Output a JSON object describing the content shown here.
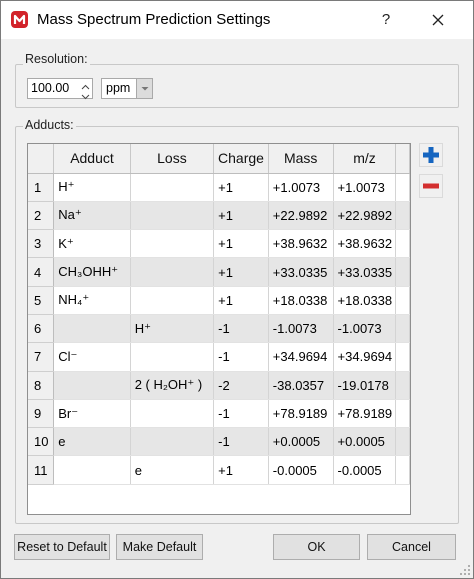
{
  "window": {
    "title": "Mass Spectrum Prediction Settings",
    "help_label": "?",
    "brand_color": "#d2232a"
  },
  "resolution": {
    "group_label": "Resolution:",
    "value": "100.00",
    "unit": "ppm"
  },
  "adducts": {
    "group_label": "Adducts:",
    "columns": [
      "Adduct",
      "Loss",
      "Charge",
      "Mass",
      "m/z"
    ],
    "rows": [
      {
        "num": "1",
        "adduct": "H⁺",
        "loss": "",
        "charge": "+1",
        "mass": "+1.0073",
        "mz": "+1.0073"
      },
      {
        "num": "2",
        "adduct": "Na⁺",
        "loss": "",
        "charge": "+1",
        "mass": "+22.9892",
        "mz": "+22.9892"
      },
      {
        "num": "3",
        "adduct": "K⁺",
        "loss": "",
        "charge": "+1",
        "mass": "+38.9632",
        "mz": "+38.9632"
      },
      {
        "num": "4",
        "adduct": "CH₃OHH⁺",
        "loss": "",
        "charge": "+1",
        "mass": "+33.0335",
        "mz": "+33.0335"
      },
      {
        "num": "5",
        "adduct": "NH₄⁺",
        "loss": "",
        "charge": "+1",
        "mass": "+18.0338",
        "mz": "+18.0338"
      },
      {
        "num": "6",
        "adduct": "",
        "loss": "H⁺",
        "charge": "-1",
        "mass": "-1.0073",
        "mz": "-1.0073"
      },
      {
        "num": "7",
        "adduct": "Cl⁻",
        "loss": "",
        "charge": "-1",
        "mass": "+34.9694",
        "mz": "+34.9694"
      },
      {
        "num": "8",
        "adduct": "",
        "loss": "2 ( H₂OH⁺ )",
        "charge": "-2",
        "mass": "-38.0357",
        "mz": "-19.0178"
      },
      {
        "num": "9",
        "adduct": "Br⁻",
        "loss": "",
        "charge": "-1",
        "mass": "+78.9189",
        "mz": "+78.9189"
      },
      {
        "num": "10",
        "adduct": "e",
        "loss": "",
        "charge": "-1",
        "mass": "+0.0005",
        "mz": "+0.0005"
      },
      {
        "num": "11",
        "adduct": "",
        "loss": "e",
        "charge": "+1",
        "mass": "-0.0005",
        "mz": "-0.0005"
      }
    ],
    "add_icon": "plus-icon",
    "remove_icon": "minus-icon",
    "add_color": "#1565c0",
    "remove_color": "#d32f2f"
  },
  "buttons": {
    "reset": "Reset to Default",
    "make_default": "Make Default",
    "ok": "OK",
    "cancel": "Cancel"
  }
}
